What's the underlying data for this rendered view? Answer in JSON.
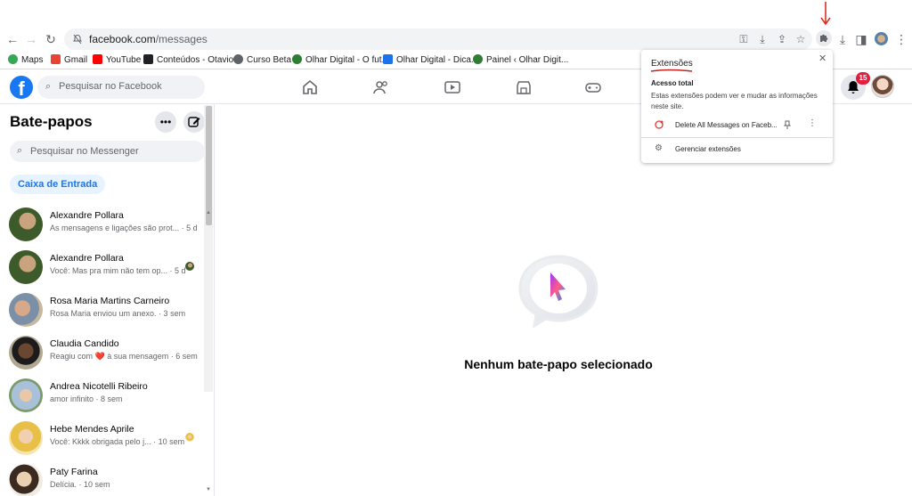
{
  "browser": {
    "url_host": "facebook.com",
    "url_path": "/messages",
    "bookmarks": [
      {
        "label": "Maps",
        "color": "#34a853"
      },
      {
        "label": "Gmail",
        "color": "#ea4335"
      },
      {
        "label": "YouTube",
        "color": "#ff0000"
      },
      {
        "label": "Conteúdos - Otavio...",
        "color": "#202124"
      },
      {
        "label": "Curso Beta",
        "color": "#5f6368"
      },
      {
        "label": "Olhar Digital - O fut...",
        "color": "#2e7d32"
      },
      {
        "label": "Olhar Digital - Dica...",
        "color": "#1a73e8"
      },
      {
        "label": "Painel ‹ Olhar Digit...",
        "color": "#2e7d32"
      }
    ]
  },
  "facebook": {
    "search_placeholder": "Pesquisar no Facebook",
    "notification_count": "15",
    "accent": "#1877f2"
  },
  "messenger": {
    "title": "Bate-papos",
    "search_placeholder": "Pesquisar no Messenger",
    "inbox_label": "Caixa de Entrada",
    "chats": [
      {
        "name": "Alexandre Pollara",
        "snippet": "As mensagens e ligações são prot... · 5 d",
        "read_receipt": false
      },
      {
        "name": "Alexandre Pollara",
        "snippet": "Você: Mas pra mim não tem op... · 5 d",
        "read_receipt": true
      },
      {
        "name": "Rosa Maria Martins Carneiro",
        "snippet": "Rosa Maria enviou um anexo. · 3 sem",
        "read_receipt": false
      },
      {
        "name": "Claudia Candido",
        "snippet": "Reagiu com ❤️ à sua mensagem · 6 sem",
        "read_receipt": false
      },
      {
        "name": "Andrea Nicotelli Ribeiro",
        "snippet": "amor infinito · 8 sem",
        "read_receipt": false
      },
      {
        "name": "Hebe Mendes Aprile",
        "snippet": "Você: Kkkk obrigada pelo j... · 10 sem",
        "read_receipt": true
      },
      {
        "name": "Paty Farina",
        "snippet": "Delícia. · 10 sem",
        "read_receipt": false
      }
    ],
    "empty_state": "Nenhum bate-papo selecionado"
  },
  "extensions_popup": {
    "title": "Extensões",
    "access_heading": "Acesso total",
    "access_desc": "Estas extensões podem ver e mudar as informações neste site.",
    "extension_name": "Delete All Messages on Faceb...",
    "manage_label": "Gerenciar extensões"
  }
}
